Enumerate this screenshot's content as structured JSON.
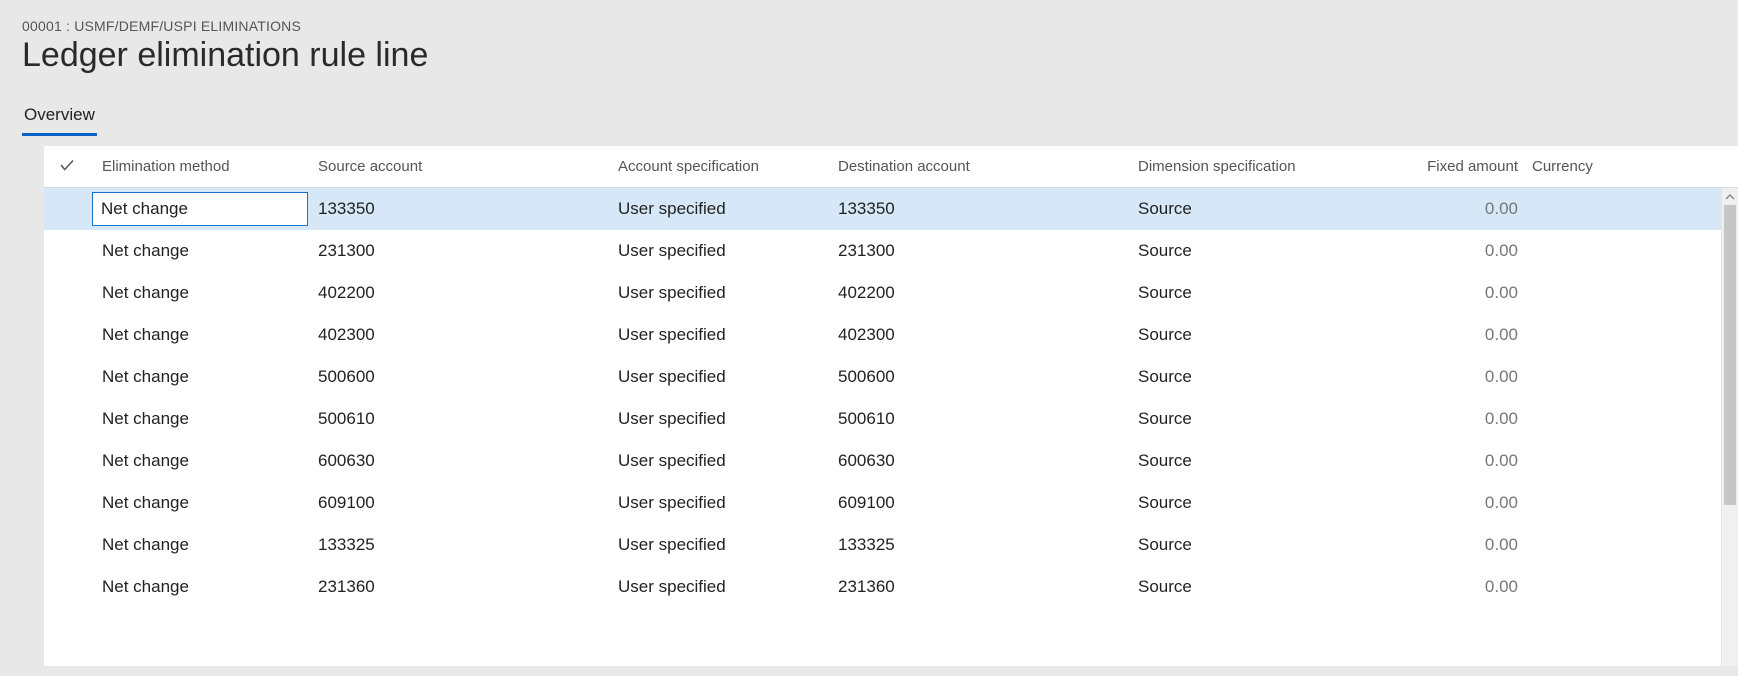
{
  "header": {
    "breadcrumb": "00001 : USMF/DEMF/USPI ELIMINATIONS",
    "title": "Ledger elimination rule line"
  },
  "tabs": [
    {
      "label": "Overview",
      "active": true
    }
  ],
  "grid": {
    "columns": {
      "elimination_method": "Elimination method",
      "source_account": "Source account",
      "account_specification": "Account specification",
      "destination_account": "Destination account",
      "dimension_specification": "Dimension specification",
      "fixed_amount": "Fixed amount",
      "currency": "Currency"
    },
    "rows": [
      {
        "elimination_method": "Net change",
        "source_account": "133350",
        "account_specification": "User specified",
        "destination_account": "133350",
        "dimension_specification": "Source",
        "fixed_amount": "0.00",
        "currency": "",
        "selected": true
      },
      {
        "elimination_method": "Net change",
        "source_account": "231300",
        "account_specification": "User specified",
        "destination_account": "231300",
        "dimension_specification": "Source",
        "fixed_amount": "0.00",
        "currency": "",
        "selected": false
      },
      {
        "elimination_method": "Net change",
        "source_account": "402200",
        "account_specification": "User specified",
        "destination_account": "402200",
        "dimension_specification": "Source",
        "fixed_amount": "0.00",
        "currency": "",
        "selected": false
      },
      {
        "elimination_method": "Net change",
        "source_account": "402300",
        "account_specification": "User specified",
        "destination_account": "402300",
        "dimension_specification": "Source",
        "fixed_amount": "0.00",
        "currency": "",
        "selected": false
      },
      {
        "elimination_method": "Net change",
        "source_account": "500600",
        "account_specification": "User specified",
        "destination_account": "500600",
        "dimension_specification": "Source",
        "fixed_amount": "0.00",
        "currency": "",
        "selected": false
      },
      {
        "elimination_method": "Net change",
        "source_account": "500610",
        "account_specification": "User specified",
        "destination_account": "500610",
        "dimension_specification": "Source",
        "fixed_amount": "0.00",
        "currency": "",
        "selected": false
      },
      {
        "elimination_method": "Net change",
        "source_account": "600630",
        "account_specification": "User specified",
        "destination_account": "600630",
        "dimension_specification": "Source",
        "fixed_amount": "0.00",
        "currency": "",
        "selected": false
      },
      {
        "elimination_method": "Net change",
        "source_account": "609100",
        "account_specification": "User specified",
        "destination_account": "609100",
        "dimension_specification": "Source",
        "fixed_amount": "0.00",
        "currency": "",
        "selected": false
      },
      {
        "elimination_method": "Net change",
        "source_account": "133325",
        "account_specification": "User specified",
        "destination_account": "133325",
        "dimension_specification": "Source",
        "fixed_amount": "0.00",
        "currency": "",
        "selected": false
      },
      {
        "elimination_method": "Net change",
        "source_account": "231360",
        "account_specification": "User specified",
        "destination_account": "231360",
        "dimension_specification": "Source",
        "fixed_amount": "0.00",
        "currency": "",
        "selected": false
      }
    ]
  }
}
